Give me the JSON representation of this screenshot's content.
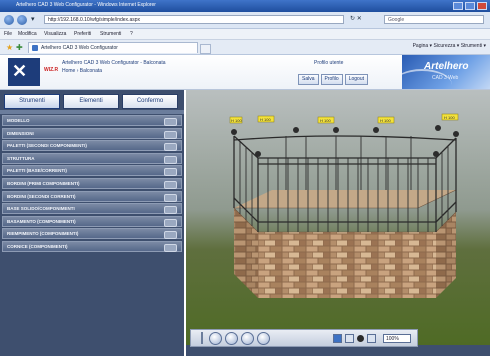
{
  "browser": {
    "title": "Artelhero CAD 3 Web Configurator - Windows Internet Explorer",
    "url": "http://192.168.0.10/wfg/simple/index.aspx",
    "search_placeholder": "Google",
    "menu": [
      "File",
      "Modifica",
      "Visualizza",
      "Preferiti",
      "Strumenti",
      "?"
    ],
    "tab_label": "Artelhero CAD 3 Web Configurator",
    "commands": "Pagina ▾  Sicurezza ▾  Strumenti ▾"
  },
  "header": {
    "logo_text": "WIZ.R",
    "app_title": "Artelhero CAD 3 Web Configurator - Balconata",
    "app_subtitle": "Home › Balconata",
    "profile": "Profilo utente",
    "buttons": [
      "Salva",
      "Profilo",
      "Logout"
    ],
    "brand_name": "Artelhero",
    "brand_sub": "CAD 3 Web"
  },
  "sidebar": {
    "tabs": [
      "Strumenti",
      "Elementi",
      "Confermo"
    ],
    "active_tab": 0,
    "rows": [
      "MODELLO",
      "DIMENSIONI",
      "PALETTI (SECONDI COMPONIMENTI)",
      "STRUTTURA",
      "PALETTI (BASE/CORRENTI)",
      "BORDINI (PRIMI COMPONIMENTI)",
      "BORDINI (SECONDI CORRENTI)",
      "BASE SOLIDO/COMPONIMENTI",
      "BASAMENTO (COMPONIMENTI)",
      "RIEMPIMENTO (COMPONIMENTI)",
      "CORNICE (COMPONIMENTI)"
    ]
  },
  "viewport": {
    "tags": [
      "H 100",
      "H 100",
      "H 100",
      "H 100",
      "H 100"
    ],
    "toolbar": {
      "zoom_label": "100%"
    }
  },
  "colors": {
    "sidebar_bg": "#3e4f6e",
    "row_bg": "#6b7a96",
    "header_blue": "#1d3c7a",
    "tag_yellow": "#f3e23a"
  }
}
